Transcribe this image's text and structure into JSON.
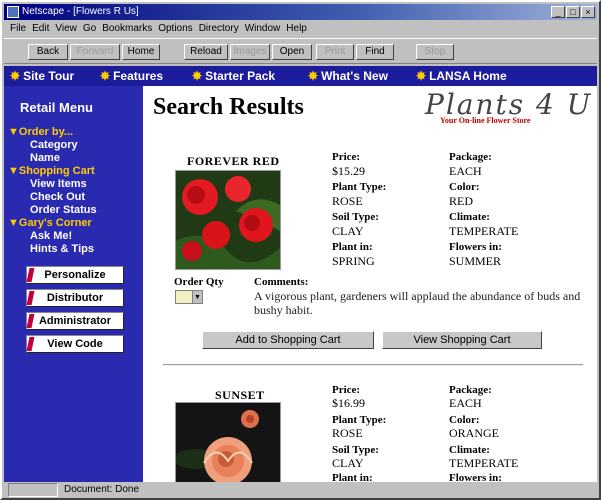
{
  "window": {
    "title": "Netscape - [Flowers R Us]",
    "minimize": "_",
    "maximize": "□",
    "close": "×"
  },
  "menubar": [
    "File",
    "Edit",
    "View",
    "Go",
    "Bookmarks",
    "Options",
    "Directory",
    "Window",
    "Help"
  ],
  "toolbar": {
    "back": "Back",
    "forward": "Forward",
    "home": "Home",
    "reload": "Reload",
    "images": "Images",
    "open": "Open",
    "print": "Print",
    "find": "Find",
    "stop": "Stop"
  },
  "nav": {
    "site_tour": "Site Tour",
    "features": "Features",
    "starter_pack": "Starter Pack",
    "whats_new": "What's New",
    "lansa_home": "LANSA Home",
    "star_color": "#ffcc00"
  },
  "sidebar": {
    "heading": "Retail Menu",
    "order_by": "▼Order by...",
    "category": "Category",
    "name": "Name",
    "shopping_cart": "▼Shopping Cart",
    "view_items": "View Items",
    "check_out": "Check Out",
    "order_status": "Order Status",
    "garys_corner": "▼Gary's Corner",
    "ask_me": "Ask Me!",
    "hints_tips": "Hints & Tips",
    "buttons": [
      "Personalize",
      "Distributor",
      "Administrator",
      "View Code"
    ]
  },
  "content": {
    "title": "Search Results",
    "logo": "Plants 4 U",
    "tagline": "Your On-line Flower Store",
    "labels": {
      "price": "Price:",
      "package": "Package:",
      "plant_type": "Plant Type:",
      "color": "Color:",
      "soil_type": "Soil Type:",
      "climate": "Climate:",
      "plant_in": "Plant in:",
      "flowers_in": "Flowers in:",
      "order_qty": "Order Qty",
      "comments": "Comments:"
    },
    "add_to_cart": "Add to Shopping Cart",
    "view_cart": "View Shopping Cart",
    "products": [
      {
        "name": "FOREVER RED",
        "price": "$15.29",
        "package": "EACH",
        "plant_type": "ROSE",
        "color": "RED",
        "soil_type": "CLAY",
        "climate": "TEMPERATE",
        "plant_in": "SPRING",
        "flowers_in": "SUMMER",
        "comments": "A vigorous plant, gardeners will applaud the abundance of buds and bushy habit."
      },
      {
        "name": "SUNSET",
        "price": "$16.99",
        "package": "EACH",
        "plant_type": "ROSE",
        "color": "ORANGE",
        "soil_type": "CLAY",
        "climate": "TEMPERATE",
        "plant_in": "",
        "flowers_in": ""
      }
    ]
  },
  "status": {
    "text": "Document: Done"
  },
  "colors": {
    "sidebar": "#2a2ab0",
    "navbar": "#1c1c9c",
    "heading_yellow": "#ffcc00",
    "titlebar": "#000080"
  }
}
